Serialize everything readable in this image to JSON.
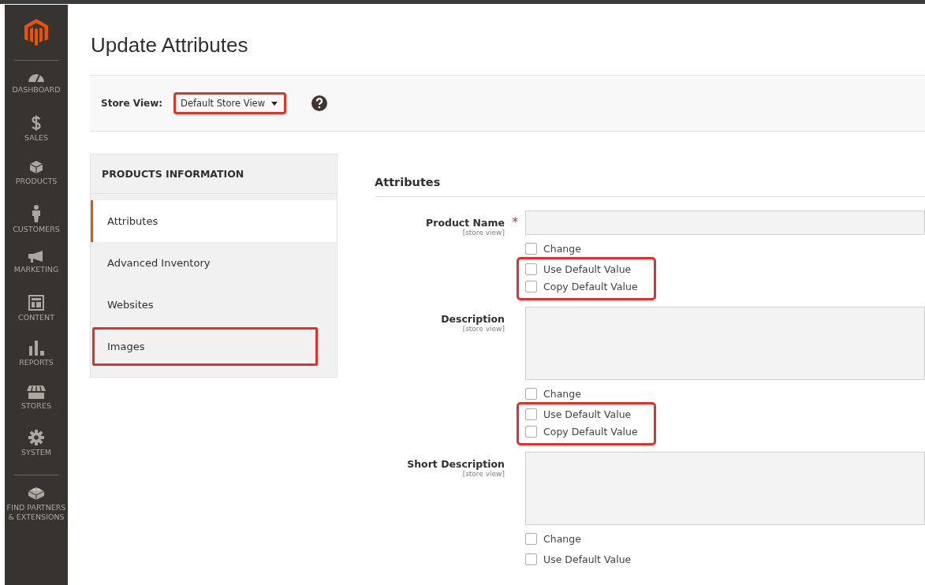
{
  "sidebar": {
    "items": [
      {
        "label": "DASHBOARD"
      },
      {
        "label": "SALES"
      },
      {
        "label": "PRODUCTS"
      },
      {
        "label": "CUSTOMERS"
      },
      {
        "label": "MARKETING"
      },
      {
        "label": "CONTENT"
      },
      {
        "label": "REPORTS"
      },
      {
        "label": "STORES"
      },
      {
        "label": "SYSTEM"
      },
      {
        "label": "FIND PARTNERS & EXTENSIONS"
      }
    ]
  },
  "page": {
    "title": "Update Attributes"
  },
  "store_view": {
    "label": "Store View:",
    "value": "Default Store View",
    "highlighted": true
  },
  "tabs": {
    "title": "PRODUCTS INFORMATION",
    "items": [
      {
        "label": "Attributes",
        "selected": true,
        "highlighted": false
      },
      {
        "label": "Advanced Inventory",
        "selected": false,
        "highlighted": false
      },
      {
        "label": "Websites",
        "selected": false,
        "highlighted": false
      },
      {
        "label": "Images",
        "selected": false,
        "highlighted": true
      }
    ]
  },
  "section": {
    "title": "Attributes"
  },
  "fields": [
    {
      "label": "Product Name",
      "scope": "[store view]",
      "required_mark": "*",
      "kind": "input",
      "change": {
        "label": "Change",
        "checked": false
      },
      "defaults": {
        "highlighted": true,
        "options": [
          {
            "label": "Use Default Value",
            "checked": false
          },
          {
            "label": "Copy Default Value",
            "checked": false
          }
        ]
      }
    },
    {
      "label": "Description",
      "scope": "[store view]",
      "kind": "textarea",
      "change": {
        "label": "Change",
        "checked": false
      },
      "defaults": {
        "highlighted": true,
        "options": [
          {
            "label": "Use Default Value",
            "checked": false
          },
          {
            "label": "Copy Default Value",
            "checked": false
          }
        ]
      }
    },
    {
      "label": "Short Description",
      "scope": "[store view]",
      "kind": "textarea",
      "change": {
        "label": "Change",
        "checked": false
      },
      "defaults": {
        "highlighted": false,
        "options": [
          {
            "label": "Use Default Value",
            "checked": false
          }
        ]
      }
    }
  ]
}
